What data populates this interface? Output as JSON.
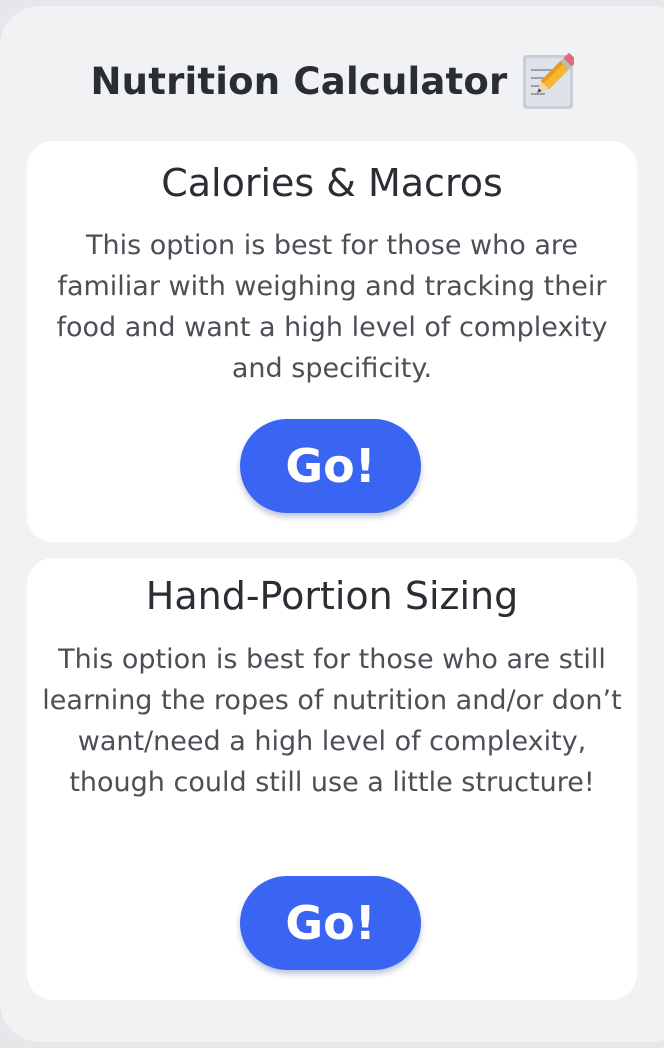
{
  "header": {
    "title": "Nutrition Calculator",
    "icon": "memo-pencil-icon"
  },
  "options": [
    {
      "title": "Calories & Macros",
      "description": "This option is best for those who are familiar with weighing and tracking their food and want a high level of complexity and specificity.",
      "button_label": "Go!"
    },
    {
      "title": "Hand-Portion Sizing",
      "description": "This option is best for those who are still learning the ropes of nutrition and/or don’t want/need a high level of complexity, though could still use a little structure!",
      "button_label": "Go!"
    }
  ],
  "colors": {
    "accent": "#3a64f2",
    "background": "#f1f2f4",
    "card": "#ffffff"
  }
}
